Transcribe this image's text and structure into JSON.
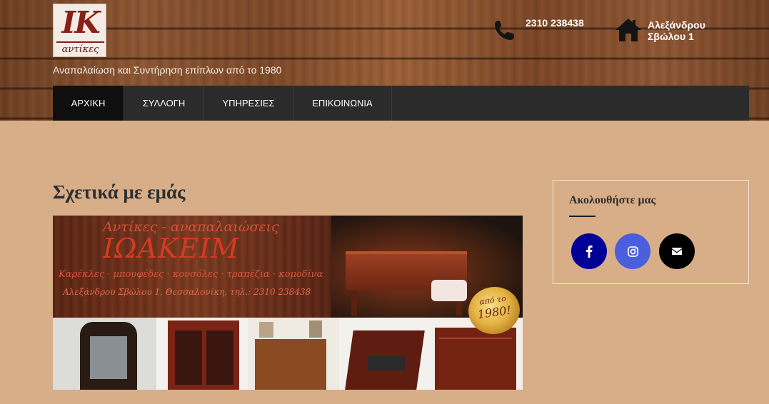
{
  "brand": {
    "logo_letters": "IK",
    "logo_subtitle": "αντίκες",
    "tagline": "Αναπαλαίωση και Συντήρηση επίπλων από το 1980"
  },
  "contact": {
    "phone": "2310 238438",
    "address_line1": "Αλεξάνδρου",
    "address_line2": "Σβώλου 1"
  },
  "nav": {
    "items": [
      {
        "label": "ΑΡΧΙΚΗ",
        "active": true
      },
      {
        "label": "ΣΥΛΛΟΓΗ",
        "active": false
      },
      {
        "label": "ΥΠΗΡΕΣΙΕΣ",
        "active": false
      },
      {
        "label": "ΕΠΙΚΟΙΝΩΝΙΑ",
        "active": false
      }
    ]
  },
  "main": {
    "title": "Σχετικά με εμάς",
    "banner": {
      "line1": "Αντίκες - αναπαλαιώσεις",
      "line2": "ΙΩΑΚΕΙΜ",
      "line3": "Καρέκλες · μπουφέδες · κονσόλες · τραπέζια · κομοδίνα",
      "line4": "Αλεξάνδρου Σβώλου 1, Θεσσαλονίκη, τηλ.: 2310 238438",
      "badge_line1": "από το",
      "badge_line2": "1980!"
    }
  },
  "sidebar": {
    "widget_title": "Ακολουθήστε μας",
    "social": [
      {
        "name": "facebook",
        "icon": "facebook-icon",
        "color": "#000099"
      },
      {
        "name": "instagram",
        "icon": "instagram-icon",
        "color": "#4b5fde"
      },
      {
        "name": "email",
        "icon": "envelope-icon",
        "color": "#000000"
      }
    ]
  },
  "colors": {
    "page_bg": "#d7ae88",
    "nav_bg": "#2b2b2b",
    "nav_active_bg": "#0f0f0f"
  }
}
